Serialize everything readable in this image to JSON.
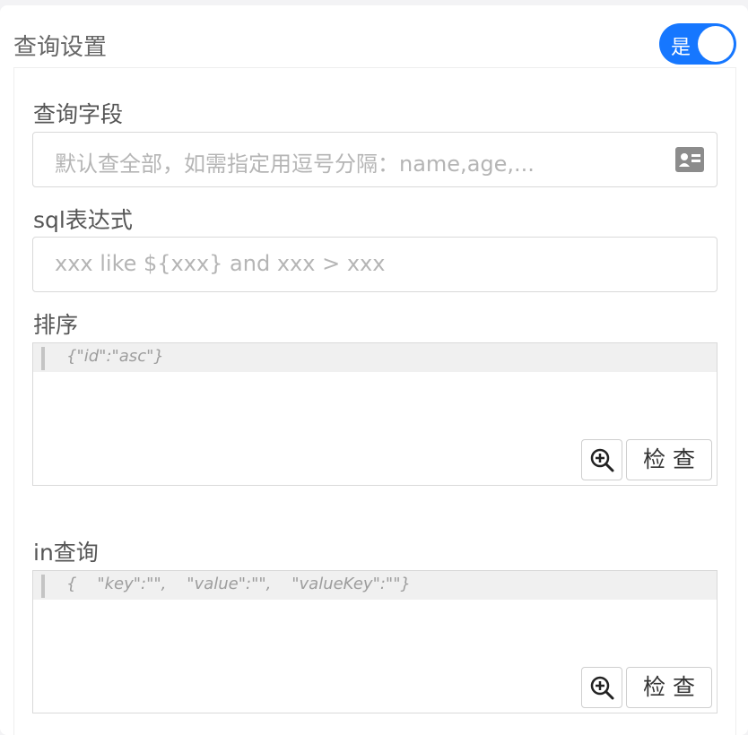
{
  "panel": {
    "title": "查询设置",
    "toggle": {
      "label": "是",
      "on": true,
      "color": "#1677ff"
    }
  },
  "fields": {
    "query_fields": {
      "label": "查询字段",
      "placeholder": "默认查全部，如需指定用逗号分隔：name,age,...",
      "icon": "id-card-icon"
    },
    "sql_expression": {
      "label": "sql表达式",
      "placeholder": "xxx like ${xxx} and xxx > xxx"
    },
    "sort": {
      "label": "排序",
      "code": "{\"id\":\"asc\"}",
      "zoom_icon": "zoom-in-icon",
      "check_label": "检查"
    },
    "in_query": {
      "label": "in查询",
      "code": "{    \"key\":\"\",    \"value\":\"\",    \"valueKey\":\"\"}",
      "zoom_icon": "zoom-in-icon",
      "check_label": "检查"
    }
  }
}
